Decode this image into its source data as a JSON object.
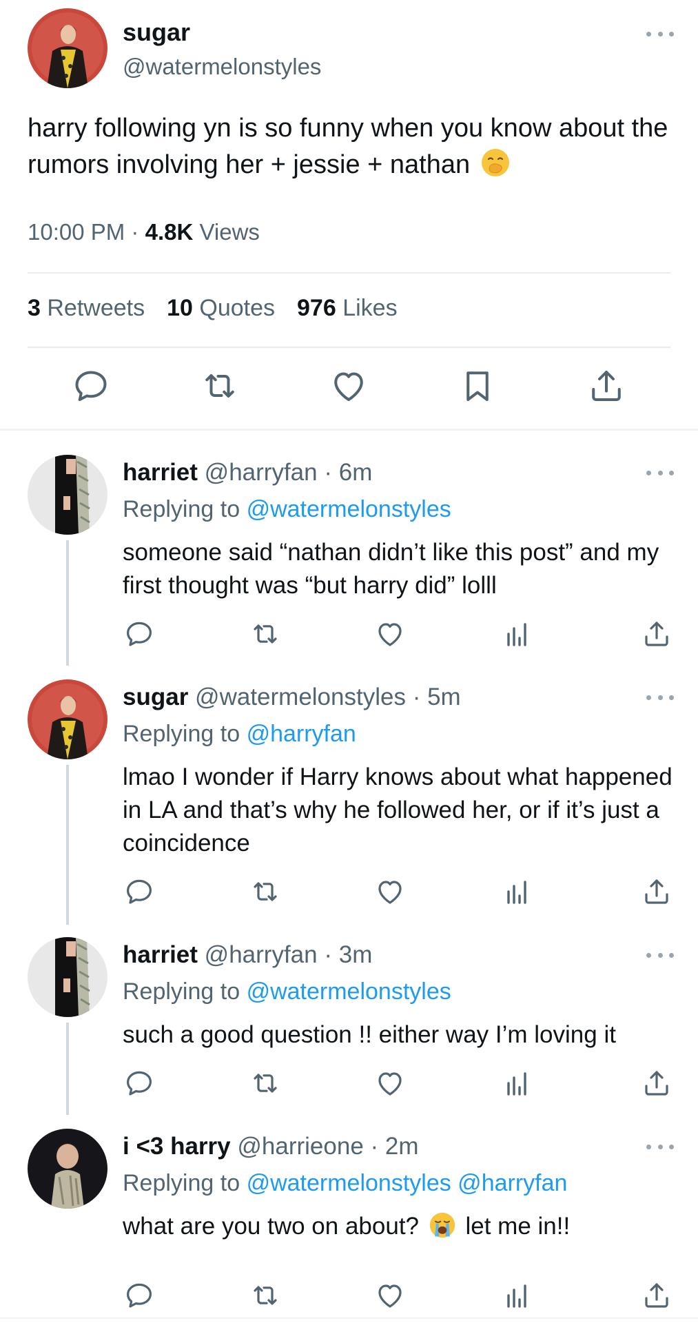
{
  "main_tweet": {
    "display_name": "sugar",
    "handle": "@watermelonstyles",
    "text": "harry following yn is so funny when you know about the rumors involving her + jessie + nathan",
    "emoji": "face-with-hand-over-mouth",
    "time": "10:00 PM",
    "separator": "·",
    "views_count": "4.8K",
    "views_label": "Views",
    "retweets_count": "3",
    "retweets_label": "Retweets",
    "quotes_count": "10",
    "quotes_label": "Quotes",
    "likes_count": "976",
    "likes_label": "Likes",
    "actions": [
      "reply-icon",
      "retweet-icon",
      "like-icon",
      "bookmark-icon",
      "share-icon"
    ]
  },
  "replies": [
    {
      "display_name": "harriet",
      "handle": "@harryfan",
      "time": "· 6m",
      "replying_label": "Replying to",
      "replying_to": "@watermelonstyles",
      "text": "someone said “nathan didn’t like this post” and my first thought was “but harry did” lolll"
    },
    {
      "display_name": "sugar",
      "handle": "@watermelonstyles",
      "time": "· 5m",
      "replying_label": "Replying to",
      "replying_to": "@harryfan",
      "text": "lmao I wonder if Harry knows about what happened in LA and that’s why he followed her, or if it’s just a coincidence"
    },
    {
      "display_name": "harriet",
      "handle": "@harryfan",
      "time": "· 3m",
      "replying_label": "Replying to",
      "replying_to": "@watermelonstyles",
      "text": "such a good question !! either way I’m loving it"
    },
    {
      "display_name": "i <3 harry",
      "handle": "@harrieone",
      "time": "· 2m",
      "replying_label": "Replying to",
      "replying_to": "@watermelonstyles @harryfan",
      "text_before": "what are you two on about?",
      "emoji": "loudly-crying-face",
      "text_after": "let me in!!"
    }
  ],
  "colors": {
    "text": "#0f1419",
    "muted": "#536471",
    "link": "#1d9bf0",
    "divider": "#e6ecf0"
  }
}
